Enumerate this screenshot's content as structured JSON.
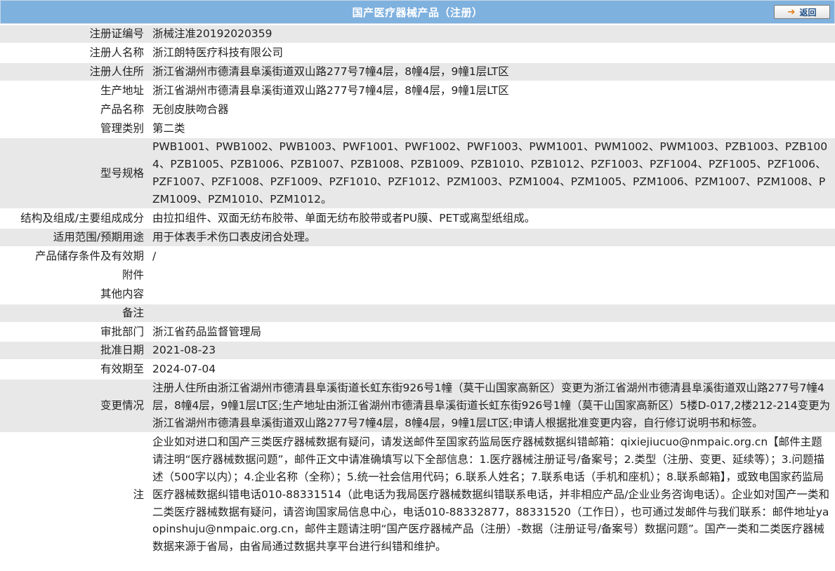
{
  "header": {
    "title": "国产医疗器械产品（注册）",
    "back_label": "返回",
    "back_icon": "arrow-right-icon",
    "bar_color": "#7fb1df"
  },
  "fields": {
    "reg_no": {
      "label": "注册证编号",
      "value": "浙械注准20192020359"
    },
    "registrant": {
      "label": "注册人名称",
      "value": "浙江朗特医疗科技有限公司"
    },
    "registrant_address": {
      "label": "注册人住所",
      "value": "浙江省湖州市德清县阜溪街道双山路277号7幢4层，8幢4层，9幢1层LT区"
    },
    "production_address": {
      "label": "生产地址",
      "value": "浙江省湖州市德清县阜溪街道双山路277号7幢4层，8幢4层，9幢1层LT区"
    },
    "product_name": {
      "label": "产品名称",
      "value": "无创皮肤吻合器"
    },
    "category": {
      "label": "管理类别",
      "value": "第二类"
    },
    "models": {
      "label": "型号规格",
      "value": "PWB1001、PWB1002、PWB1003、PWF1001、PWF1002、PWF1003、PWM1001、PWM1002、PWM1003、PZB1003、PZB1004、PZB1005、PZB1006、PZB1007、PZB1008、PZB1009、PZB1010、PZB1012、PZF1003、PZF1004、PZF1005、PZF1006、PZF1007、PZF1008、PZF1009、PZF1010、PZF1012、PZM1003、PZM1004、PZM1005、PZM1006、PZM1007、PZM1008、PZM1009、PZM1010、PZM1012。"
    },
    "structure": {
      "label": "结构及组成/主要组成成分",
      "value": "由拉扣组件、双面无纺布胶带、单面无纺布胶带或者PU膜、PET或离型纸组成。"
    },
    "scope": {
      "label": "适用范围/预期用途",
      "value": "用于体表手术伤口表皮闭合处理。"
    },
    "storage": {
      "label": "产品储存条件及有效期",
      "value": "/"
    },
    "attachment": {
      "label": "附件",
      "value": ""
    },
    "other": {
      "label": "其他内容",
      "value": ""
    },
    "remark": {
      "label": "备注",
      "value": ""
    },
    "department": {
      "label": "审批部门",
      "value": "浙江省药品监督管理局"
    },
    "approval_date": {
      "label": "批准日期",
      "value": "2021-08-23"
    },
    "valid_until": {
      "label": "有效期至",
      "value": "2024-07-04"
    },
    "changes": {
      "label": "变更情况",
      "value": "注册人住所由浙江省湖州市德清县阜溪街道长虹东街926号1幢（莫干山国家高新区）变更为浙江省湖州市德清县阜溪街道双山路277号7幢4层，8幢4层，9幢1层LT区;生产地址由浙江省湖州市德清县阜溪街道长虹东街926号1幢（莫干山国家高新区）5楼D-017,2楼212-214变更为浙江省湖州市德清县阜溪街道双山路277号7幢4层，8幢4层，9幢1层LT区;申请人根据批准变更内容，自行修订说明书和标签。"
    },
    "note": {
      "label": "注",
      "value": "企业如对进口和国产三类医疗器械数据有疑问，请发送邮件至国家药监局医疗器械数据纠错邮箱：qixiejiucuo@nmpaic.org.cn【邮件主题请注明“医疗器械数据问题”，邮件正文中请准确填写以下全部信息：1.医疗器械注册证号/备案号；2.类型（注册、变更、延续等）；3.问题描述（500字以内）；4.企业名称（全称）；5.统一社会信用代码；6.联系人姓名；7.联系电话（手机和座机）；8.联系邮箱】，或致电国家药监局医疗器械数据纠错电话010-88331514（此电话为我局医疗器械数据纠错联系电话，并非相应产品/企业业务咨询电话）。企业如对国产一类和二类医疗器械数据有疑问，请咨询国家局信息中心，电话010-88332877，88331520（工作日），也可通过发邮件与我们联系：邮件地址yaopinshuju@nmpaic.org.cn，邮件主题请注明“国产医疗器械产品（注册）-数据（注册证号/备案号）数据问题”。国产一类和二类医疗器械数据来源于省局，由省局通过数据共享平台进行纠错和维护。"
    }
  }
}
